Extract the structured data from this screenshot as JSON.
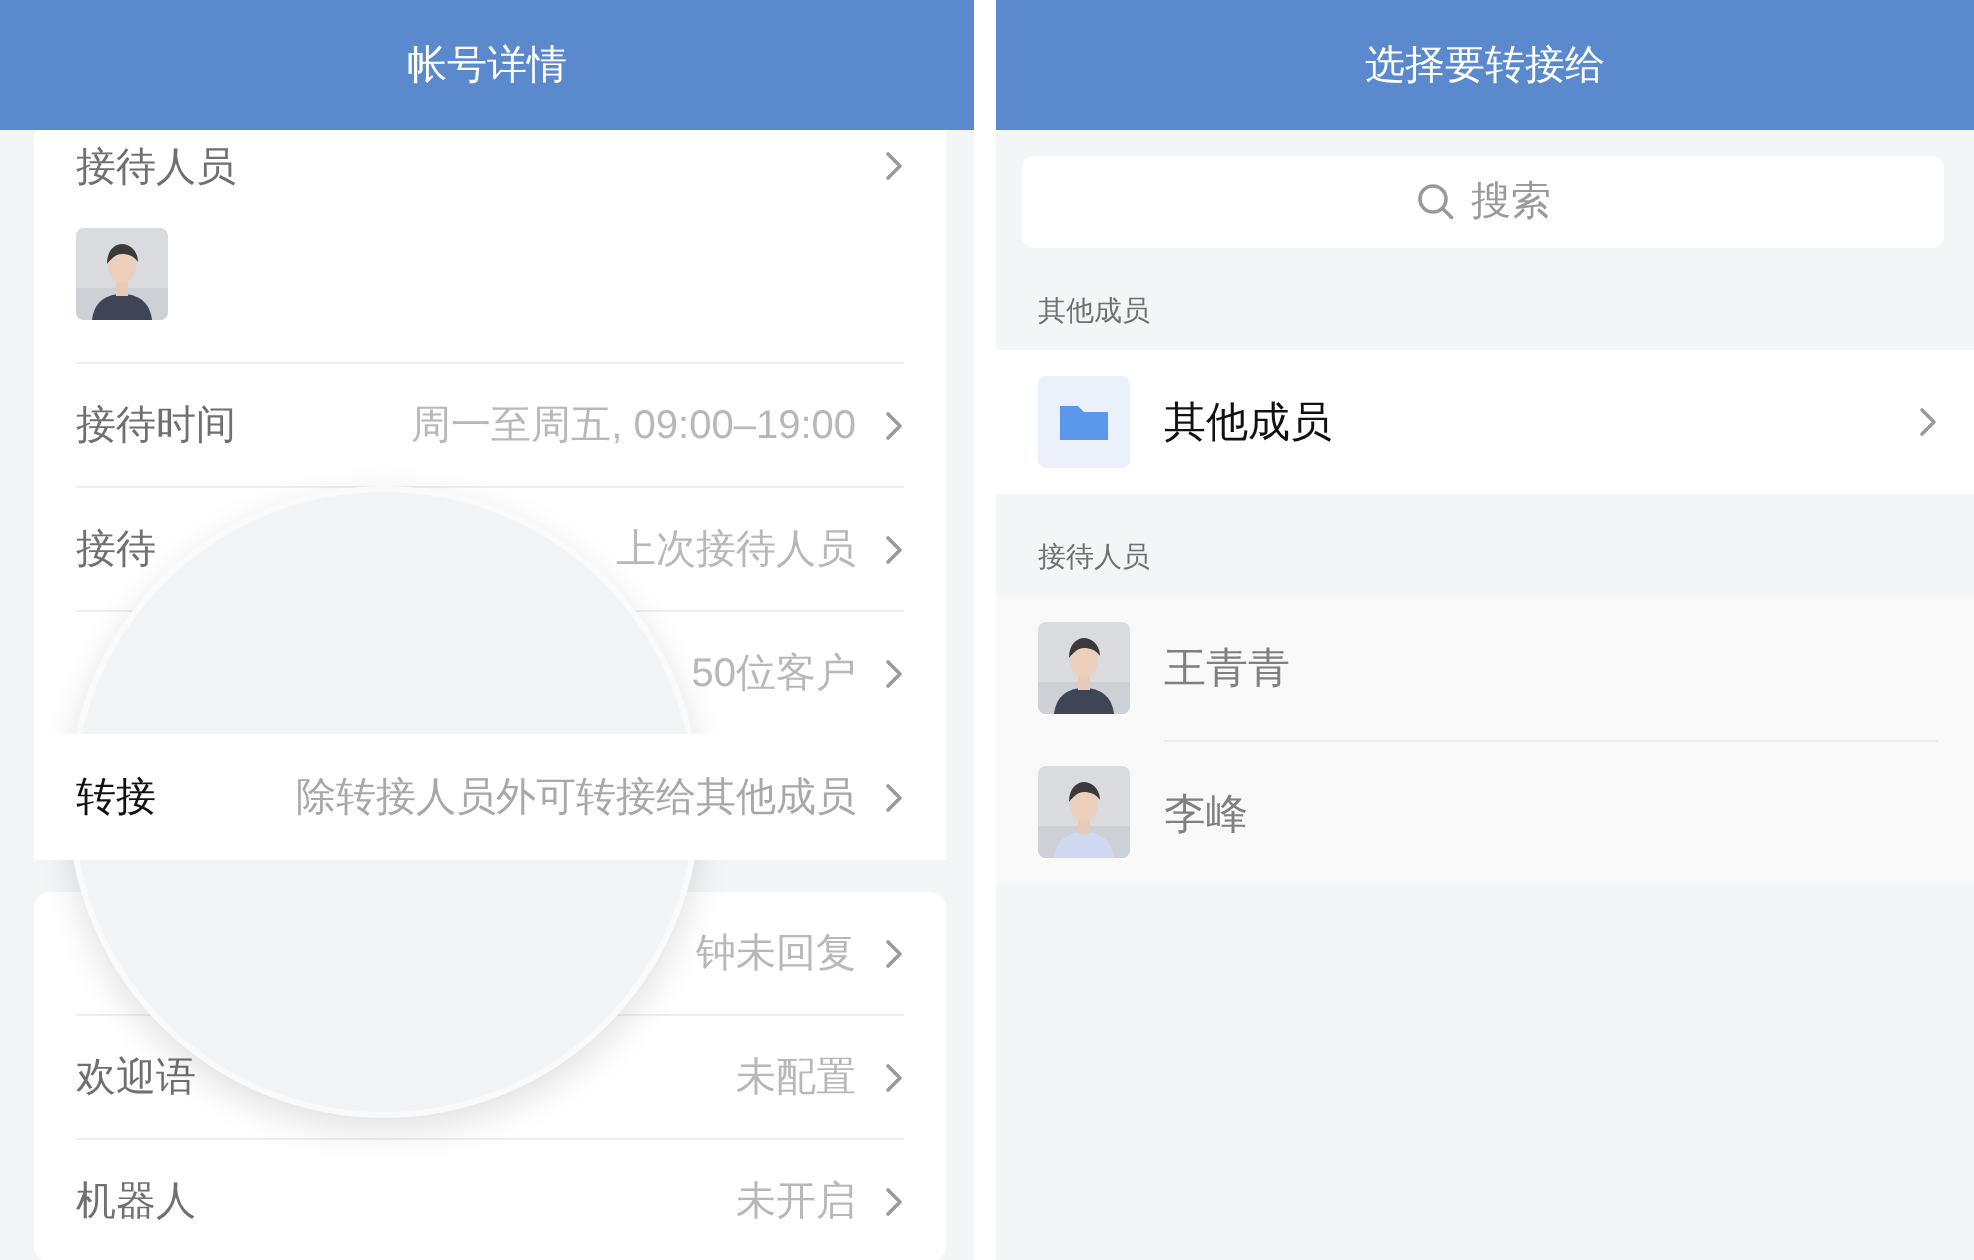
{
  "left": {
    "header": {
      "title": "帐号详情"
    },
    "cards": [
      {
        "rows": [
          {
            "kind": "staff",
            "label": "接待人员"
          },
          {
            "kind": "setting",
            "label": "接待时间",
            "value": "周一至周五, 09:00–19:00",
            "magnified": false
          },
          {
            "kind": "setting",
            "label": "接待",
            "value": "上次接待人员",
            "magnified": false
          },
          {
            "kind": "setting",
            "value": "50位客户",
            "magnified": false
          },
          {
            "kind": "setting",
            "label": "转接",
            "value": "除转接人员外可转接给其他成员",
            "magnified": true
          }
        ]
      },
      {
        "rows": [
          {
            "kind": "setting",
            "value": "钟未回复",
            "magnified": false
          },
          {
            "kind": "setting",
            "label": "欢迎语",
            "value": "未配置",
            "magnified": false
          },
          {
            "kind": "setting",
            "label": "机器人",
            "value": "未开启",
            "magnified": false
          }
        ]
      }
    ]
  },
  "right": {
    "header": {
      "title": "选择要转接给"
    },
    "search": {
      "placeholder": "搜索"
    },
    "sections": [
      {
        "title": "其他成员",
        "items": [
          {
            "kind": "folder",
            "name": "其他成员",
            "disabled": false
          }
        ]
      },
      {
        "title": "接待人员",
        "items": [
          {
            "kind": "person",
            "name": "王青青",
            "disabled": true
          },
          {
            "kind": "person",
            "name": "李峰",
            "disabled": true
          }
        ]
      }
    ]
  }
}
